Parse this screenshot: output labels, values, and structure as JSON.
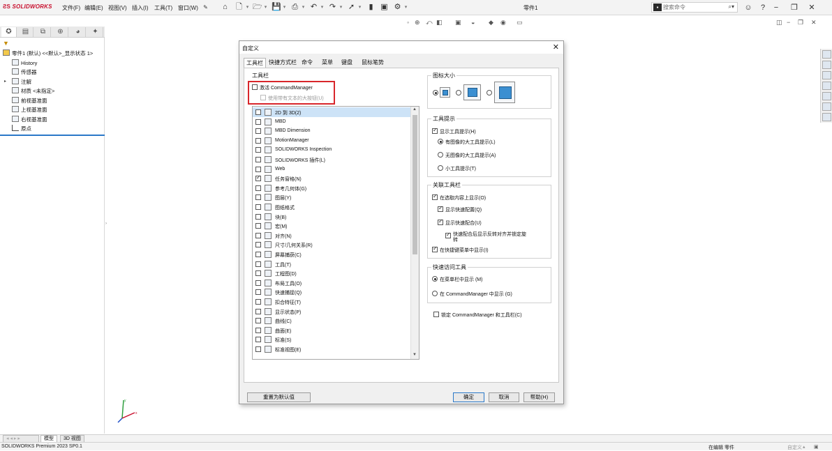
{
  "app": {
    "logo_text": "SOLIDWORKS",
    "doc_title": "零件1",
    "menus": [
      "文件(F)",
      "编辑(E)",
      "视图(V)",
      "插入(I)",
      "工具(T)",
      "窗口(W)"
    ],
    "search_placeholder": "搜索命令"
  },
  "feature_tree": {
    "root": "零件1 (默认) <<默认>_显示状态 1>",
    "items": [
      "History",
      "传感器",
      "注解",
      "材质 <未指定>",
      "前视基准面",
      "上视基准面",
      "右视基准面",
      "原点"
    ]
  },
  "dialog": {
    "title": "自定义",
    "tabs": [
      "工具栏",
      "快捷方式栏",
      "命令",
      "菜单",
      "键盘",
      "鼠标笔势"
    ],
    "toolbar_group_label": "工具栏",
    "activate_cm": "激活 CommandManager",
    "use_large_buttons": "使用带有文本的大按钮(U)",
    "toolbars": [
      {
        "label": "2D 到 3D(2)",
        "checked": false
      },
      {
        "label": "MBD",
        "checked": false
      },
      {
        "label": "MBD Dimension",
        "checked": false
      },
      {
        "label": "MotionManager",
        "checked": false
      },
      {
        "label": "SOLIDWORKS Inspection",
        "checked": false
      },
      {
        "label": "SOLIDWORKS 插件(L)",
        "checked": false
      },
      {
        "label": "Web",
        "checked": false
      },
      {
        "label": "任务窗格(N)",
        "checked": true
      },
      {
        "label": "参考几何体(G)",
        "checked": false
      },
      {
        "label": "图层(Y)",
        "checked": false
      },
      {
        "label": "图纸格式",
        "checked": false
      },
      {
        "label": "块(B)",
        "checked": false
      },
      {
        "label": "宏(M)",
        "checked": false
      },
      {
        "label": "对齐(N)",
        "checked": false
      },
      {
        "label": "尺寸/几何关系(R)",
        "checked": false
      },
      {
        "label": "屏幕捕获(C)",
        "checked": false
      },
      {
        "label": "工具(T)",
        "checked": false
      },
      {
        "label": "工程图(D)",
        "checked": false
      },
      {
        "label": "布局工具(O)",
        "checked": false
      },
      {
        "label": "快速捕捉(Q)",
        "checked": false
      },
      {
        "label": "扣合特征(T)",
        "checked": false
      },
      {
        "label": "显示状态(P)",
        "checked": false
      },
      {
        "label": "曲线(C)",
        "checked": false
      },
      {
        "label": "曲面(E)",
        "checked": false
      },
      {
        "label": "标准(S)",
        "checked": false
      },
      {
        "label": "标准视图(E)",
        "checked": false
      }
    ],
    "icon_size_label": "图标大小",
    "tooltip_label": "工具提示",
    "show_tooltips": "显示工具提示(H)",
    "tooltip_opt1": "有图像的大工具提示(L)",
    "tooltip_opt2": "无图像的大工具提示(A)",
    "tooltip_opt3": "小工具提示(T)",
    "context_label": "关联工具栏",
    "ctx_show_on_select": "在选取内容上显示(O)",
    "ctx_quick_config": "显示快速配置(Q)",
    "ctx_quick_mate": "显示快速配合(U)",
    "ctx_flip_align": "快速配合后显示反转对齐并锁定旋转",
    "ctx_shortcut_menu": "在快捷键菜单中显示(I)",
    "quick_access_label": "快速访问工具",
    "qa_menubar": "在菜单栏中显示 (M)",
    "qa_cm": "在 CommandManager 中显示 (G)",
    "lock_cm": "锁定 CommandManager 和工具栏(C)",
    "reset_button": "重置为默认值",
    "ok_button": "确定",
    "cancel_button": "取消",
    "help_button": "帮助(H)"
  },
  "bottom": {
    "tabs": [
      "模型",
      "3D 视图"
    ],
    "status_left": "SOLIDWORKS Premium 2023 SP0.1",
    "status_right": "在编辑 零件",
    "status_custom": "自定义"
  },
  "colors": {
    "highlight_red": "#d8262b",
    "selection_blue": "#cde3f7",
    "accent_blue": "#2a78c8"
  }
}
